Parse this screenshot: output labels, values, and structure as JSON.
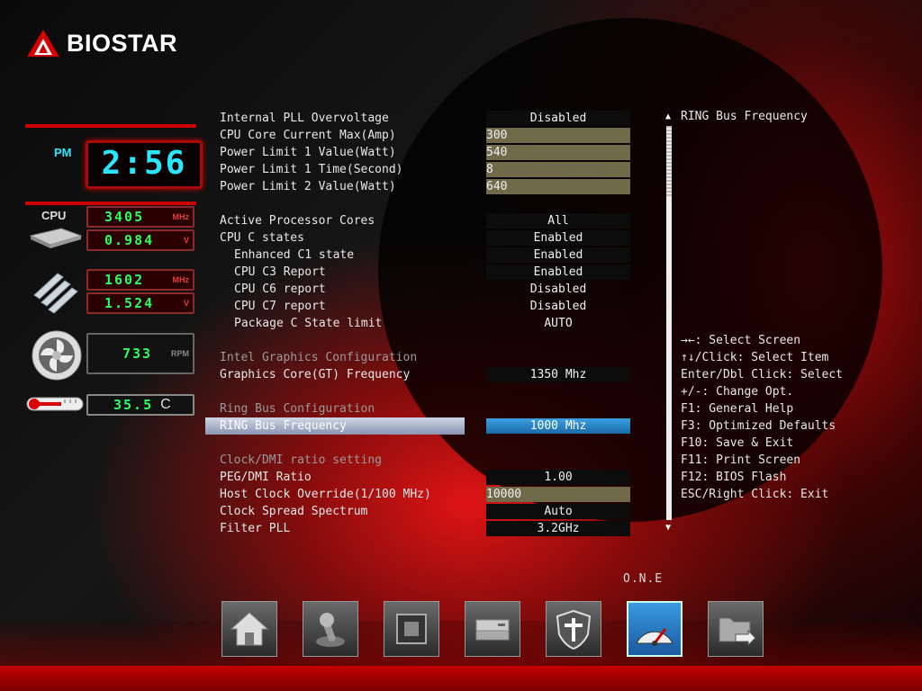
{
  "brand": {
    "logo_text": "BIOSTAR",
    "accent_color": "#c40000"
  },
  "status": {
    "ampm": "PM",
    "time": "2:56",
    "cpu_label": "CPU",
    "cpu_freq": "3405",
    "cpu_freq_unit": "MHz",
    "cpu_volt": "0.984",
    "cpu_volt_unit": "V",
    "mem_freq": "1602",
    "mem_freq_unit": "MHz",
    "mem_volt": "1.524",
    "mem_volt_unit": "V",
    "fan_rpm": "733",
    "fan_unit": "RPM",
    "temp": "35.5",
    "temp_unit": "C"
  },
  "settings": [
    {
      "label": "Internal PLL Overvoltage",
      "value": "Disabled",
      "kind": "select"
    },
    {
      "label": "CPU Core Current Max(Amp)",
      "value": "300",
      "kind": "edit"
    },
    {
      "label": "Power Limit 1 Value(Watt)",
      "value": "540",
      "kind": "edit"
    },
    {
      "label": "Power Limit 1 Time(Second)",
      "value": "8",
      "kind": "edit"
    },
    {
      "label": "Power Limit 2 Value(Watt)",
      "value": "640",
      "kind": "edit"
    },
    {
      "label": "Active Processor Cores",
      "value": "All",
      "kind": "select"
    },
    {
      "label": "CPU C states",
      "value": "Enabled",
      "kind": "select"
    },
    {
      "label": "Enhanced C1 state",
      "value": "Enabled",
      "kind": "select"
    },
    {
      "label": "CPU C3 Report",
      "value": "Enabled",
      "kind": "select"
    },
    {
      "label": "CPU C6 report",
      "value": "Disabled",
      "kind": "plain"
    },
    {
      "label": "CPU C7 report",
      "value": "Disabled",
      "kind": "plain"
    },
    {
      "label": "Package C State limit",
      "value": "AUTO",
      "kind": "plain"
    },
    {
      "label": "Intel Graphics Configuration"
    },
    {
      "label": "Graphics Core(GT) Frequency",
      "value": "1350 Mhz",
      "kind": "select"
    },
    {
      "label": "Ring Bus Configuration"
    },
    {
      "label": "RING Bus Frequency",
      "value": "1000 Mhz",
      "kind": "selected"
    },
    {
      "label": "Clock/DMI ratio setting"
    },
    {
      "label": "PEG/DMI Ratio",
      "value": "1.00",
      "kind": "select"
    },
    {
      "label": "Host Clock Override(1/100 MHz)",
      "value": "10000",
      "kind": "edit"
    },
    {
      "label": "Clock Spread Spectrum",
      "value": "Auto",
      "kind": "select"
    },
    {
      "label": "Filter PLL",
      "value": "3.2GHz",
      "kind": "select"
    }
  ],
  "help": {
    "title": "RING Bus Frequency",
    "keys": [
      "→←: Select Screen",
      "↑↓/Click: Select Item",
      "Enter/Dbl Click: Select",
      "+/-: Change Opt.",
      "F1: General Help",
      "F3: Optimized Defaults",
      "F10: Save & Exit",
      "F11: Print Screen",
      "F12: BIOS Flash",
      "ESC/Right Click: Exit"
    ]
  },
  "dock": {
    "active_label": "O.N.E",
    "items": [
      {
        "name": "home-icon"
      },
      {
        "name": "joystick-icon"
      },
      {
        "name": "chip-icon"
      },
      {
        "name": "drive-icon"
      },
      {
        "name": "security-shield-icon"
      },
      {
        "name": "speedometer-icon",
        "active": true
      },
      {
        "name": "folder-exit-icon"
      }
    ]
  }
}
